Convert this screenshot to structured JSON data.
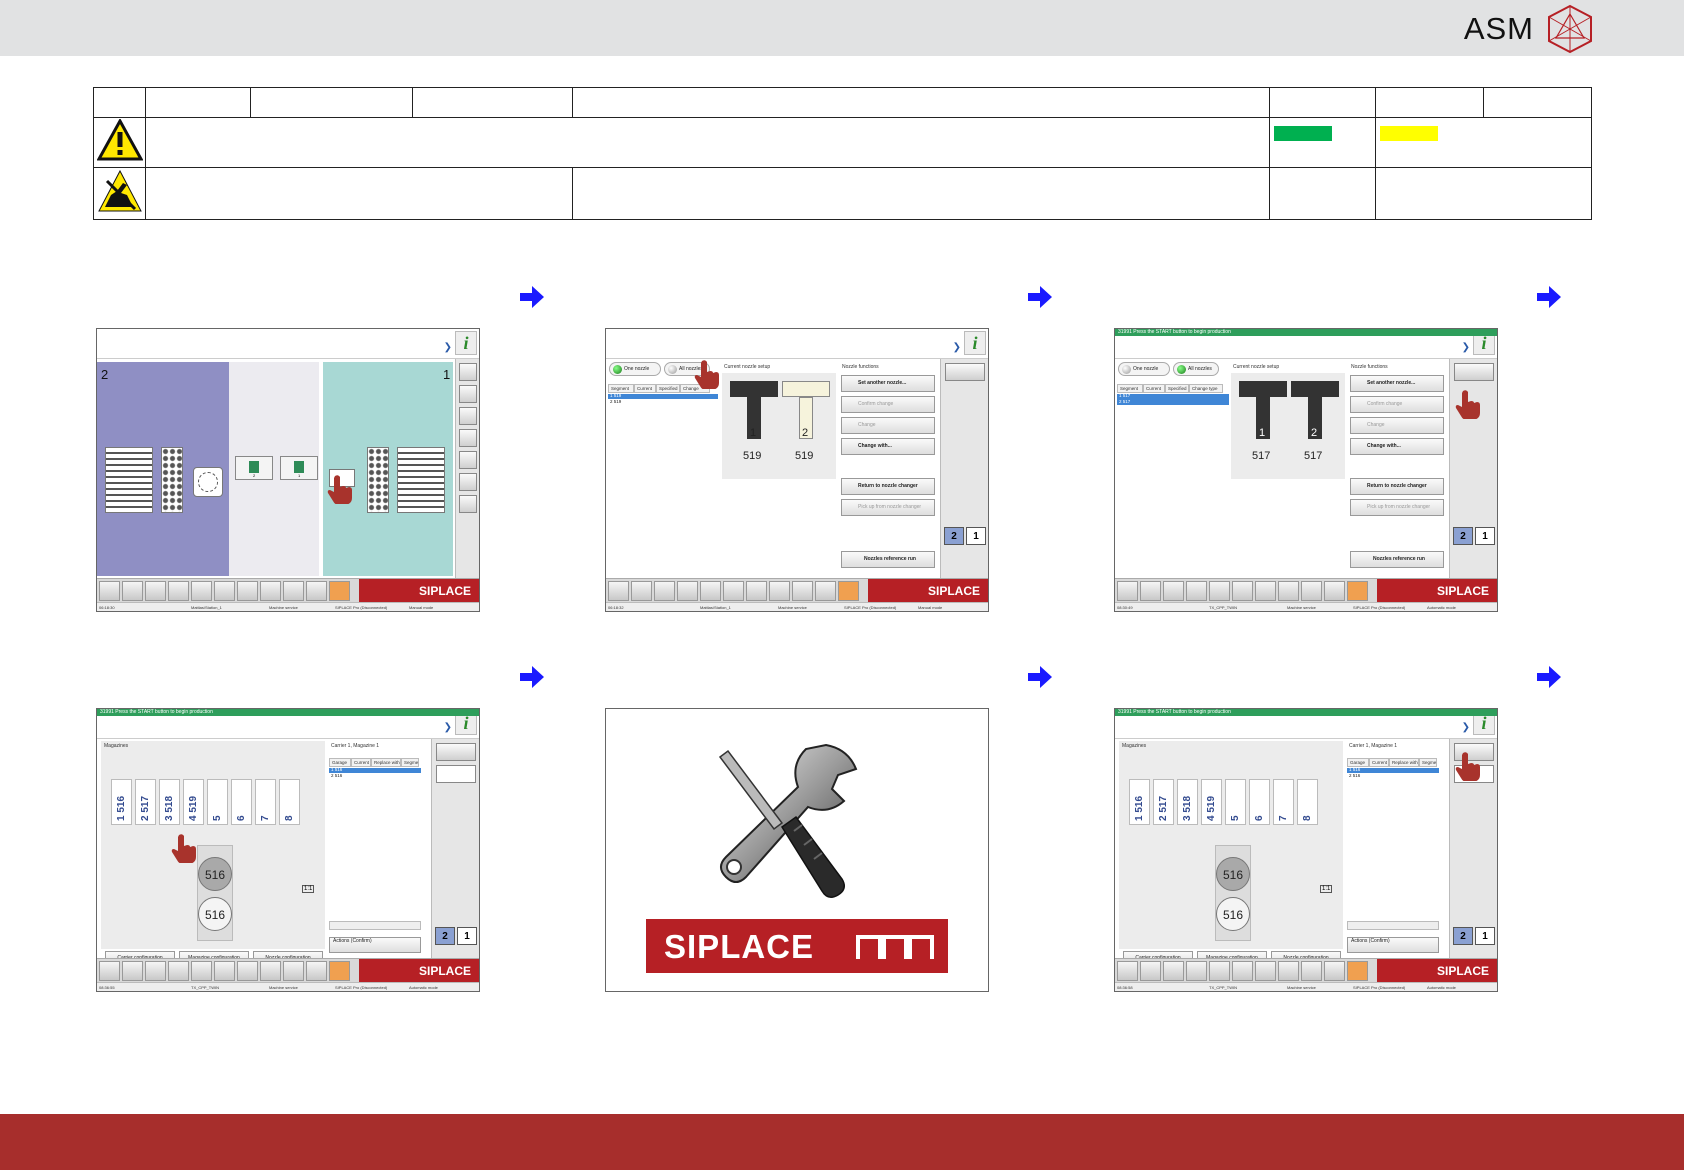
{
  "brand": {
    "logo_text": "ASM"
  },
  "screens": {
    "s1": {
      "label_left": "2",
      "label_right": "1",
      "bar_brand": "SIPLACE",
      "status_a": "Mattias\\Station_1",
      "status_b": "Machine service",
      "status_c": "SIPLACE Pro (Disconnected)",
      "status_d": "Manual mode",
      "time": "06:18:30",
      "slot_a": "2",
      "slot_b": "1"
    },
    "s2": {
      "tab_one": "One nozzle",
      "tab_all": "All nozzles",
      "col_segment": "Segment",
      "col_current": "Current",
      "col_specified": "Specified",
      "col_change": "Change",
      "row1": "1      519",
      "row2": "2      519",
      "current_setup": "Current nozzle setup",
      "nozzle_functions": "Nozzle functions",
      "noz1": "1",
      "noz2": "2",
      "val1": "519",
      "val2": "519",
      "btn_set_another": "Set another nozzle...",
      "btn_confirm": "Confirm change",
      "btn_change": "Change",
      "btn_change_with": "Change with...",
      "btn_return": "Return to nozzle changer",
      "btn_pickup": "Pick up from nozzle changer",
      "btn_ref": "Nozzles reference run",
      "seg2": "2",
      "seg1": "1",
      "bar_brand": "SIPLACE",
      "status_a": "Mattias\\Station_1",
      "status_b": "Machine service",
      "status_c": "SIPLACE Pro (Disconnected)",
      "status_d": "Manual mode",
      "time": "06:18:32"
    },
    "s3": {
      "status_msg": "31991 Press the START button to begin production",
      "tab_one": "One nozzle",
      "tab_all": "All nozzles",
      "col_segment": "Segment",
      "col_current": "Current",
      "col_specified": "Specified",
      "col_change": "Change type",
      "row1": "1      517",
      "row2": "2      517",
      "current_setup": "Current nozzle setup",
      "nozzle_functions": "Nozzle functions",
      "noz1": "1",
      "noz2": "2",
      "val1": "517",
      "val2": "517",
      "btn_set_another": "Set another nozzle...",
      "btn_confirm": "Confirm change",
      "btn_change": "Change",
      "btn_change_with": "Change with...",
      "btn_return": "Return to nozzle changer",
      "btn_pickup": "Pick up from nozzle changer",
      "btn_ref": "Nozzles reference run",
      "seg2": "2",
      "seg1": "1",
      "bar_brand": "SIPLACE",
      "status_a": "TX_CPP_TWIN",
      "status_b": "Machine service",
      "status_c": "SIPLACE Pro (Disconnected)",
      "status_d": "Automatic mode",
      "time": "08:30:49"
    },
    "s4": {
      "status_msg": "31991 Press the START button to begin production",
      "magazines": "Magazines",
      "carrier_title": "Carrier 1, Magazine 1",
      "col_garage": "Garage",
      "col_current": "Current",
      "col_replace": "Replace with",
      "col_segment": "Segme",
      "row1": "1     516",
      "row2": "2     516",
      "slots": [
        "1 516",
        "2 517",
        "3 518",
        "4 519",
        "5",
        "6",
        "7",
        "8"
      ],
      "circle_top": "516",
      "circle_bottom": "516",
      "zoom_reset": "1:1",
      "btn_carrier": "Carrier configuration",
      "btn_magazine": "Magazine configuration",
      "btn_nozzle": "Nozzle configuration",
      "actions": "Actions (Confirm)",
      "seg2": "2",
      "seg1": "1",
      "bar_brand": "SIPLACE",
      "status_a": "TX_CPP_TWIN",
      "status_b": "Machine service",
      "status_c": "SIPLACE Pro (Disconnected)",
      "status_d": "Automatic mode",
      "time": "08:36:55"
    },
    "s5": {
      "brand": "SIPLACE"
    },
    "s6": {
      "status_msg": "31991 Press the START button to begin production",
      "magazines": "Magazines",
      "carrier_title": "Carrier 1, Magazine 1",
      "col_garage": "Garage",
      "col_current": "Current",
      "col_replace": "Replace with",
      "col_segment": "Segme",
      "row1": "1     516",
      "row2": "2     516",
      "slots": [
        "1 516",
        "2 517",
        "3 518",
        "4 519",
        "5",
        "6",
        "7",
        "8"
      ],
      "circle_top": "516",
      "circle_bottom": "516",
      "zoom_reset": "1:1",
      "btn_carrier": "Carrier configuration",
      "btn_magazine": "Magazine configuration",
      "btn_nozzle": "Nozzle configuration",
      "actions": "Actions (Confirm)",
      "seg2": "2",
      "seg1": "1",
      "bar_brand": "SIPLACE",
      "status_a": "TX_CPP_TWIN",
      "status_b": "Machine service",
      "status_c": "SIPLACE Pro (Disconnected)",
      "status_d": "Automatic mode",
      "time": "08:36:58"
    }
  },
  "colors": {
    "footer": "#a72e2c",
    "brand_red": "#b62025",
    "arrow": "#1a1aff",
    "ok_green": "#00b050",
    "warn_yellow": "#ffff00"
  },
  "icons": [
    "warning-icon",
    "esd-icon",
    "arrow-right-icon",
    "hand-pointer-icon",
    "info-icon",
    "tools-icon"
  ]
}
